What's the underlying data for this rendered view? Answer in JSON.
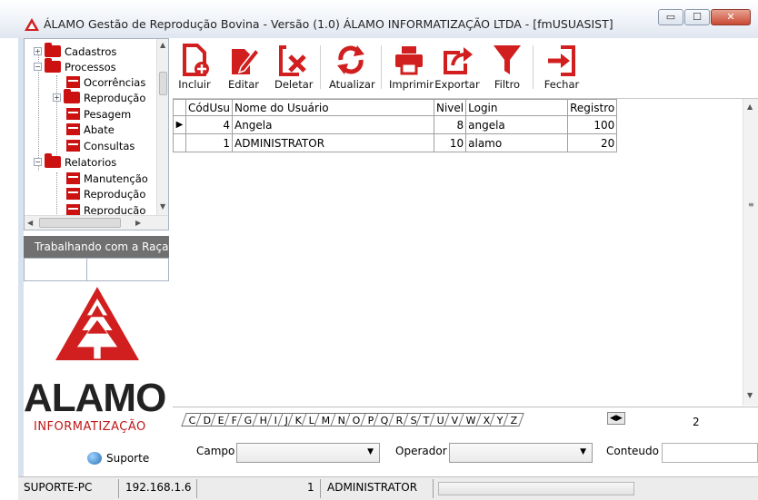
{
  "window": {
    "title": "ÁLAMO Gestão de Reprodução Bovina - Versão (1.0) ÁLAMO INFORMATIZAÇÃO LTDA - [fmUSUASIST]",
    "buttons": {
      "minimize": "▭",
      "maximize": "☐",
      "close": "✕"
    }
  },
  "tree": {
    "items": [
      {
        "label": "Cadastros",
        "expander": "+"
      },
      {
        "label": "Processos",
        "expander": "−"
      },
      {
        "label": "Ocorrências"
      },
      {
        "label": "Reprodução",
        "expander": "+"
      },
      {
        "label": "Pesagem"
      },
      {
        "label": "Abate"
      },
      {
        "label": "Consultas"
      },
      {
        "label": "Relatorios",
        "expander": "−"
      },
      {
        "label": "Manutenção"
      },
      {
        "label": "Reprodução"
      },
      {
        "label": "Reproducão"
      }
    ]
  },
  "raca": {
    "header": "Trabalhando com a Raça"
  },
  "logo": {
    "name": "ALAMO",
    "subtitle": "INFORMATIZAÇÃO",
    "support_label": "Suporte",
    "brand_color": "#c01818"
  },
  "toolbar": {
    "incluir": "Incluir",
    "editar": "Editar",
    "deletar": "Deletar",
    "atualizar": "Atualizar",
    "imprimir": "Imprimir",
    "exportar": "Exportar",
    "filtro": "Filtro",
    "fechar": "Fechar",
    "icon_color": "#d11f1f"
  },
  "grid": {
    "headers": {
      "id": "CódUsu",
      "name": "Nome do Usuário",
      "level": "Nivel",
      "login": "Login",
      "registros": "Registro"
    },
    "rows": [
      {
        "id": "4",
        "name": "Angela",
        "level": "8",
        "login": "angela",
        "registros": "100"
      },
      {
        "id": "1",
        "name": "ADMINISTRATOR",
        "level": "10",
        "login": "alamo",
        "registros": "20"
      }
    ]
  },
  "alphabet": {
    "letters": [
      "C",
      "D",
      "E",
      "F",
      "G",
      "H",
      "I",
      "J",
      "K",
      "L",
      "M",
      "N",
      "O",
      "P",
      "Q",
      "R",
      "S",
      "T",
      "U",
      "V",
      "W",
      "X",
      "Y",
      "Z"
    ],
    "nav": "◀▶",
    "count": "2"
  },
  "filter": {
    "campo_label": "Campo",
    "operador_label": "Operador",
    "conteudo_label": "Conteudo"
  },
  "status": {
    "host": "SUPORTE-PC",
    "ip": "192.168.1.6",
    "user_level": "1",
    "user": "ADMINISTRATOR"
  }
}
